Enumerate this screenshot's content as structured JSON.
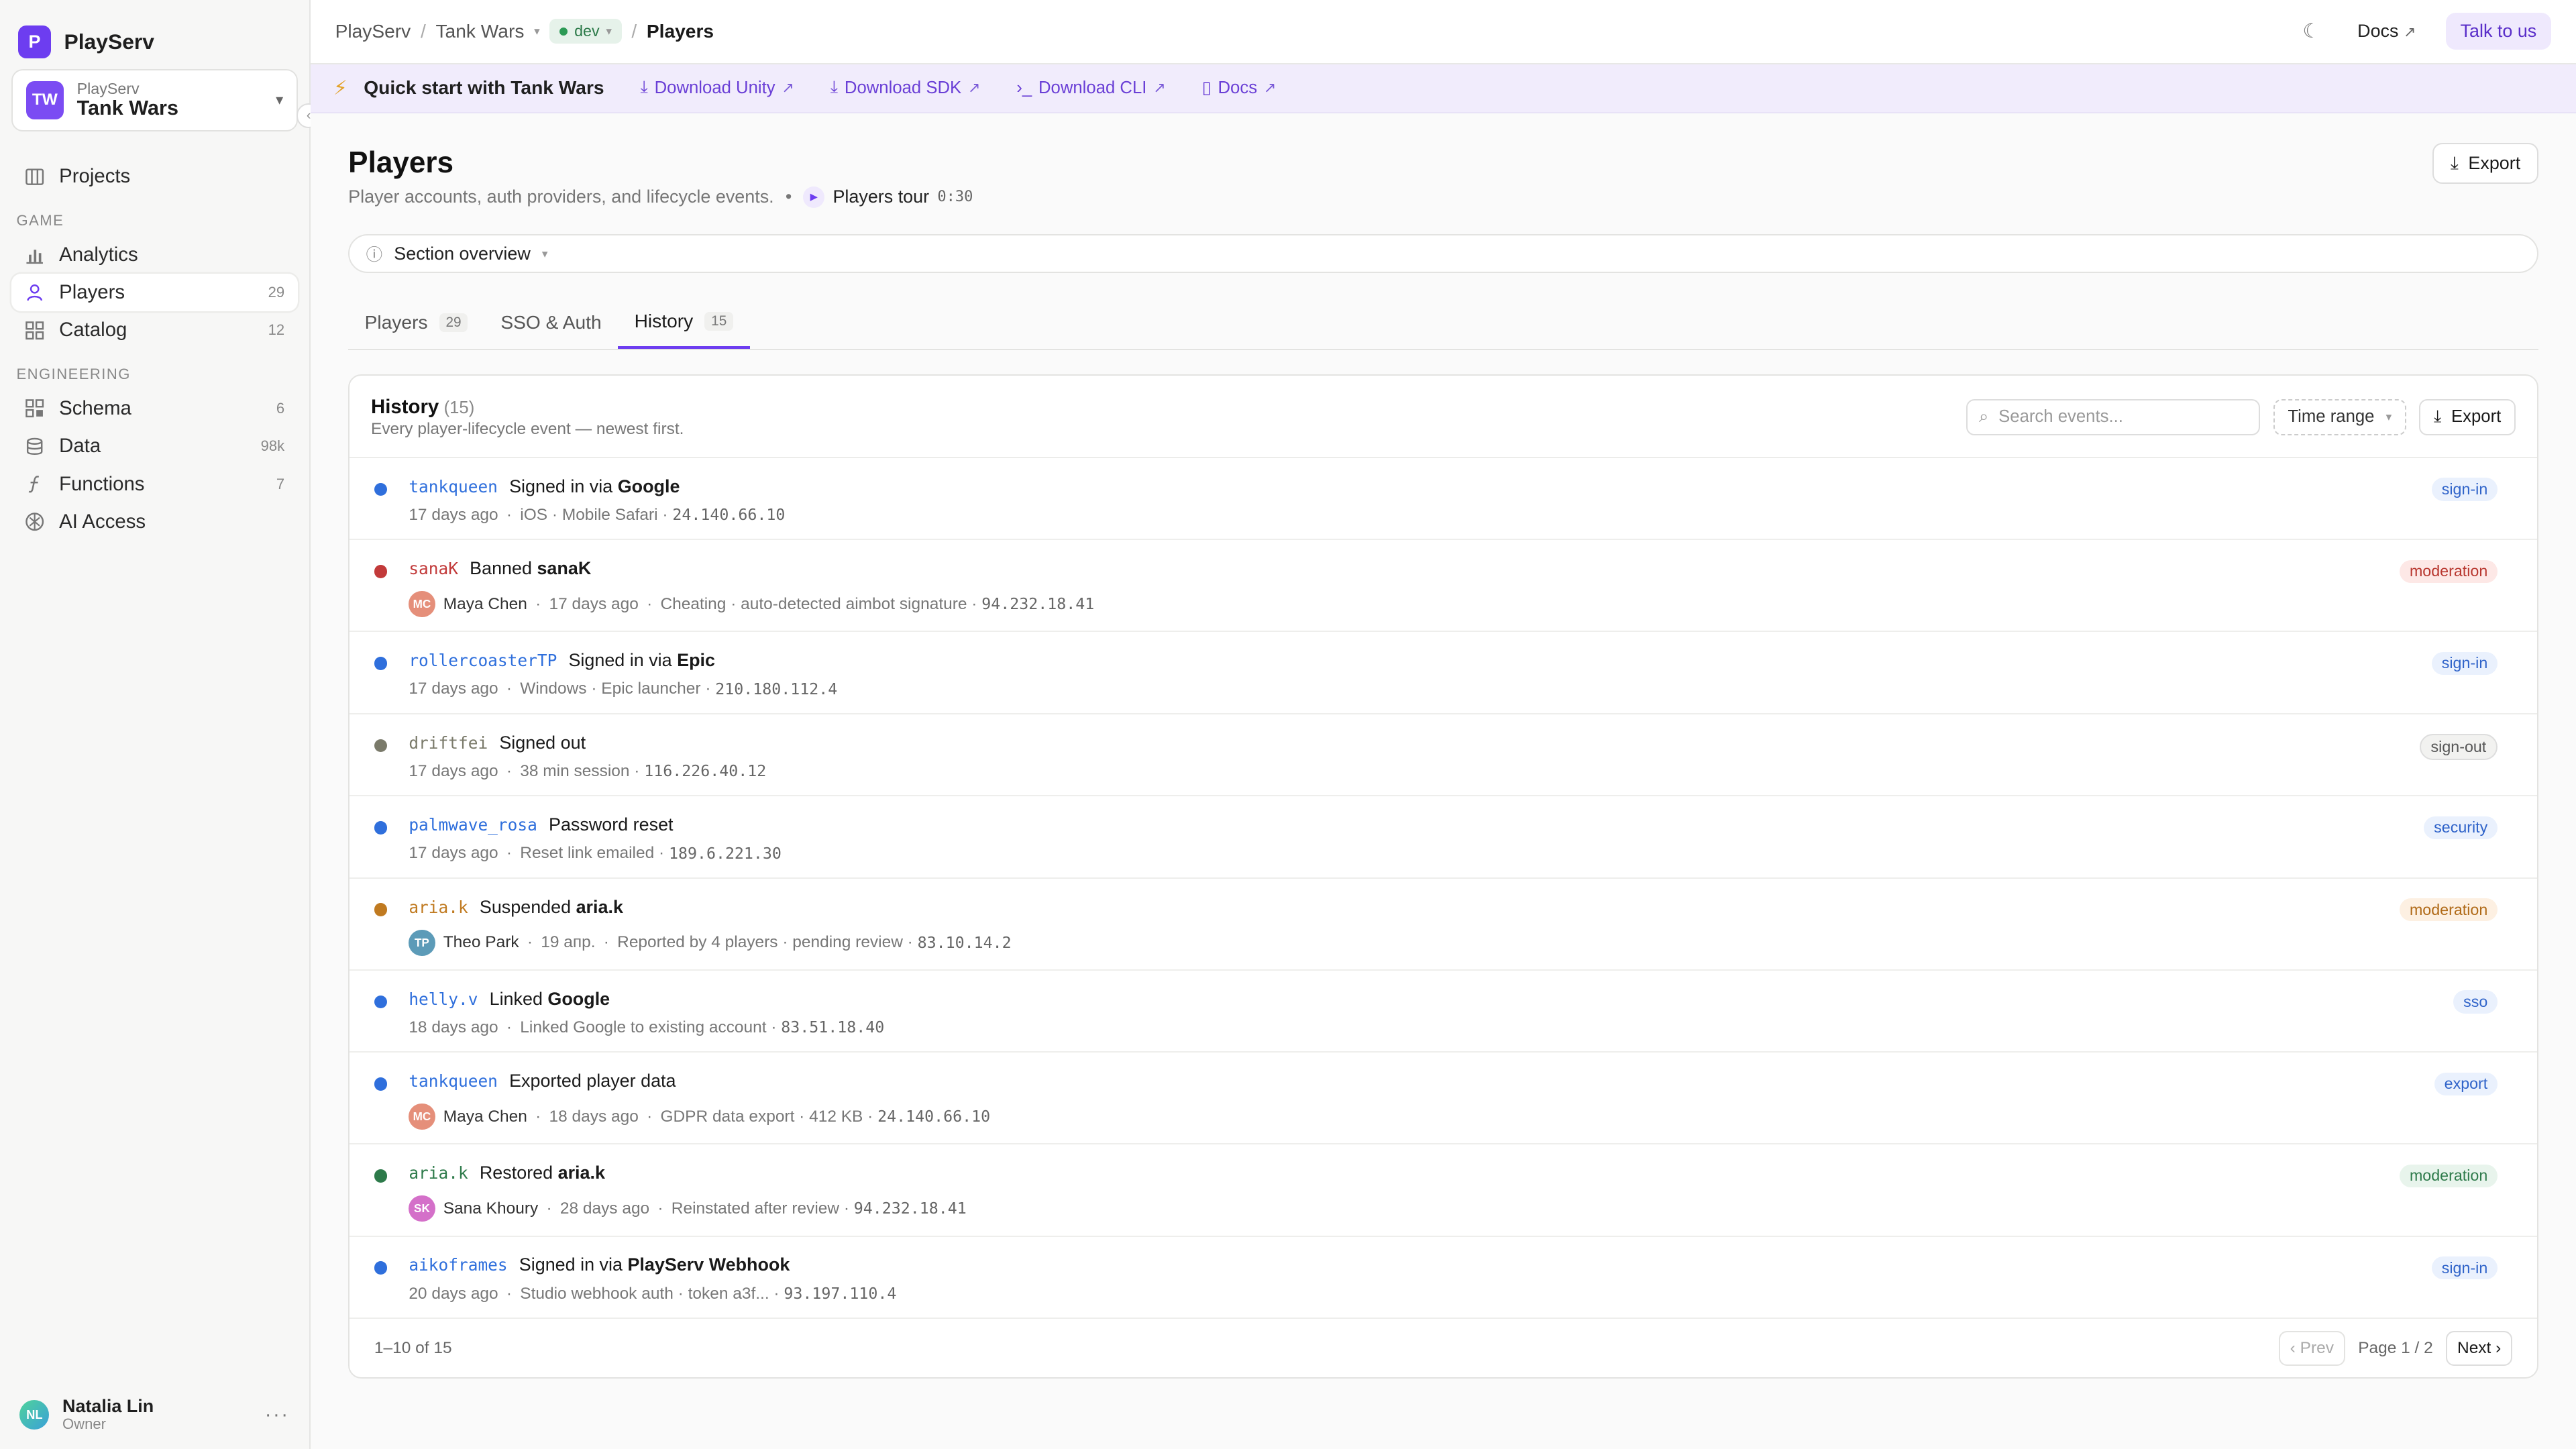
{
  "sidebar": {
    "brand": {
      "logo_letter": "P",
      "name": "PlayServ"
    },
    "project": {
      "initials": "TW",
      "org": "PlayServ",
      "name": "Tank Wars"
    },
    "top_items": [
      {
        "label": "Projects",
        "icon": "columns-icon"
      }
    ],
    "sections": [
      {
        "title": "GAME",
        "items": [
          {
            "label": "Analytics",
            "count": "",
            "icon": "bar-chart-icon"
          },
          {
            "label": "Players",
            "count": "29",
            "icon": "user-icon",
            "active": true
          },
          {
            "label": "Catalog",
            "count": "12",
            "icon": "grid-icon"
          }
        ]
      },
      {
        "title": "ENGINEERING",
        "items": [
          {
            "label": "Schema",
            "count": "6",
            "icon": "schema-icon"
          },
          {
            "label": "Data",
            "count": "98k",
            "icon": "database-icon"
          },
          {
            "label": "Functions",
            "count": "7",
            "icon": "function-icon"
          },
          {
            "label": "AI Access",
            "count": "",
            "icon": "ai-icon"
          }
        ]
      }
    ],
    "user": {
      "initials": "NL",
      "name": "Natalia Lin",
      "role": "Owner"
    }
  },
  "topbar": {
    "crumbs": [
      "PlayServ",
      "Tank Wars"
    ],
    "env": "dev",
    "current": "Players",
    "docs": "Docs",
    "talk": "Talk to us"
  },
  "quickstart": {
    "title": "Quick start with Tank Wars",
    "links": [
      {
        "label": "Download Unity",
        "icon": "download-icon"
      },
      {
        "label": "Download SDK",
        "icon": "download-icon"
      },
      {
        "label": "Download CLI",
        "icon": "terminal-icon"
      },
      {
        "label": "Docs",
        "icon": "book-icon"
      }
    ]
  },
  "page": {
    "title": "Players",
    "subtitle": "Player accounts, auth providers, and lifecycle events.",
    "tour_label": "Players tour",
    "tour_time": "0:30",
    "export": "Export",
    "overview": "Section overview"
  },
  "tabs": [
    {
      "label": "Players",
      "count": "29"
    },
    {
      "label": "SSO & Auth",
      "count": ""
    },
    {
      "label": "History",
      "count": "15",
      "active": true
    }
  ],
  "history": {
    "title": "History",
    "count": "(15)",
    "subtitle": "Every player-lifecycle event — newest first.",
    "search_placeholder": "Search events...",
    "time_range": "Time range",
    "export": "Export",
    "rows": [
      {
        "actor": "tankqueen",
        "action": "Signed in via",
        "target": "Google",
        "by": null,
        "meta": [
          "17 days ago",
          "iOS · Mobile Safari · "
        ],
        "ip": "24.140.66.10",
        "tag": "sign-in",
        "color": "#2f6fdc"
      },
      {
        "actor": "sanaK",
        "action": "Banned",
        "target": "sanaK",
        "by": {
          "initials": "MC",
          "name": "Maya Chen"
        },
        "meta": [
          "17 days ago",
          "Cheating · auto-detected aimbot signature · "
        ],
        "ip": "94.232.18.41",
        "tag": "moderation",
        "color": "#c23a3a"
      },
      {
        "actor": "rollercoasterTP",
        "action": "Signed in via",
        "target": "Epic",
        "by": null,
        "meta": [
          "17 days ago",
          "Windows · Epic launcher · "
        ],
        "ip": "210.180.112.4",
        "tag": "sign-in",
        "color": "#2f6fdc"
      },
      {
        "actor": "driftfei",
        "action": "Signed out",
        "target": "",
        "by": null,
        "meta": [
          "17 days ago",
          "38 min session · "
        ],
        "ip": "116.226.40.12",
        "tag": "sign-out",
        "color": "#7a7a6a"
      },
      {
        "actor": "palmwave_rosa",
        "action": "Password reset",
        "target": "",
        "by": null,
        "meta": [
          "17 days ago",
          "Reset link emailed · "
        ],
        "ip": "189.6.221.30",
        "tag": "security",
        "color": "#2f6fdc"
      },
      {
        "actor": "aria.k",
        "action": "Suspended",
        "target": "aria.k",
        "by": {
          "initials": "TP",
          "name": "Theo Park"
        },
        "meta": [
          "19 апр.",
          "Reported by 4 players · pending review · "
        ],
        "ip": "83.10.14.2",
        "tag": "moderation",
        "color": "#c07a20"
      },
      {
        "actor": "helly.v",
        "action": "Linked",
        "target": "Google",
        "by": null,
        "meta": [
          "18 days ago",
          "Linked Google to existing account · "
        ],
        "ip": "83.51.18.40",
        "tag": "sso",
        "color": "#2f6fdc"
      },
      {
        "actor": "tankqueen",
        "action": "Exported player data",
        "target": "",
        "by": {
          "initials": "MC",
          "name": "Maya Chen"
        },
        "meta": [
          "18 days ago",
          "GDPR data export · 412 KB · "
        ],
        "ip": "24.140.66.10",
        "tag": "export",
        "color": "#2f6fdc"
      },
      {
        "actor": "aria.k",
        "action": "Restored",
        "target": "aria.k",
        "by": {
          "initials": "SK",
          "name": "Sana Khoury"
        },
        "meta": [
          "28 days ago",
          "Reinstated after review · "
        ],
        "ip": "94.232.18.41",
        "tag": "moderation",
        "color": "#2d7a4a"
      },
      {
        "actor": "aikoframes",
        "action": "Signed in via",
        "target": "PlayServ Webhook",
        "by": null,
        "meta": [
          "20 days ago",
          "Studio webhook auth · token a3f... · "
        ],
        "ip": "93.197.110.4",
        "tag": "sign-in",
        "color": "#2f6fdc"
      }
    ],
    "footer": {
      "range": "1–10 of 15",
      "prev": "‹ Prev",
      "page": "Page 1 / 2",
      "next": "Next ›"
    }
  }
}
